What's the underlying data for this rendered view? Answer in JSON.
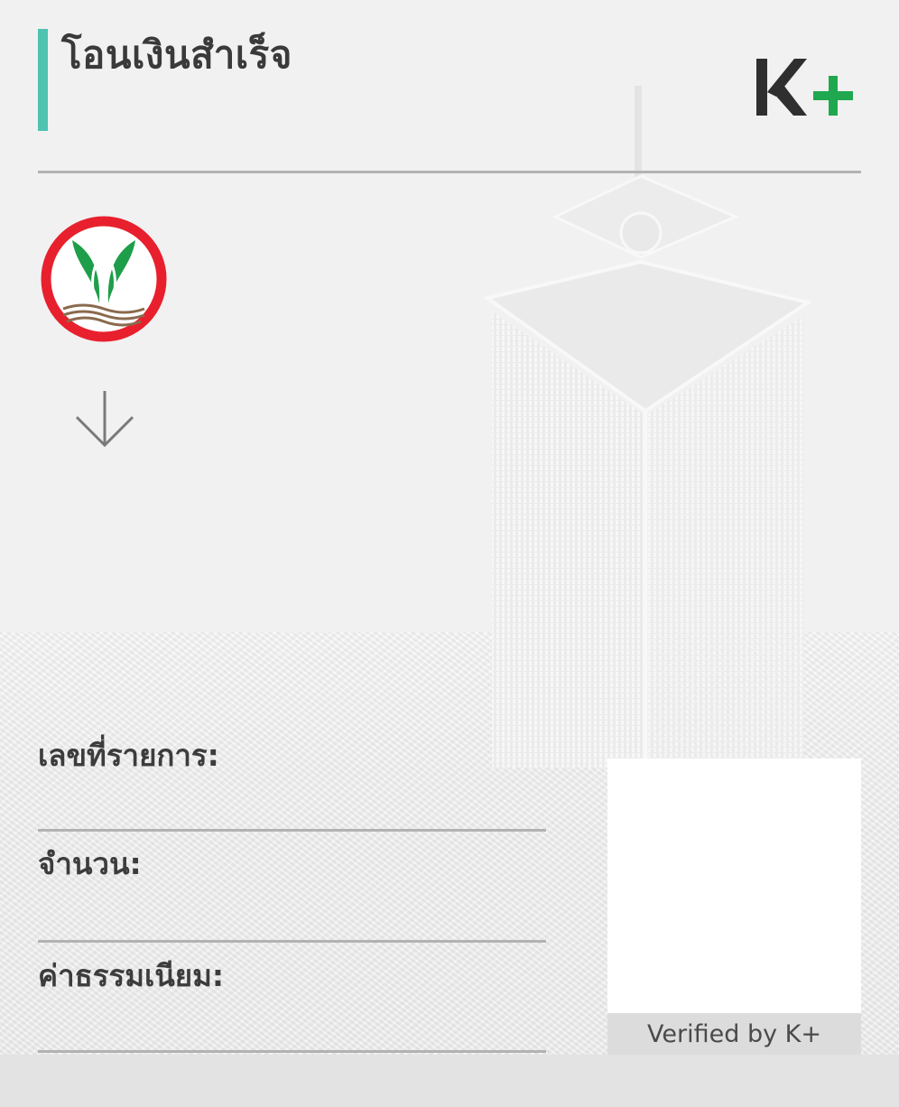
{
  "header": {
    "title": "โอนเงินสำเร็จ",
    "brand_logo": "K+",
    "accent_color": "#4fc3b0"
  },
  "bank": {
    "logo_icon": "kasikorn-bank-logo"
  },
  "transfer": {
    "direction_icon": "arrow-down-icon"
  },
  "fields": {
    "reference_label": "เลขที่รายการ:",
    "amount_label": "จำนวน:",
    "fee_label": "ค่าธรรมเนียม:"
  },
  "verification": {
    "label": "Verified by K+"
  }
}
